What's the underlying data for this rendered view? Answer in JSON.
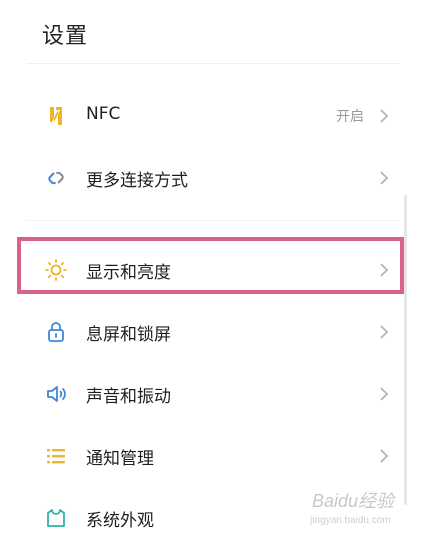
{
  "header": {
    "title": "设置"
  },
  "items": [
    {
      "label": "NFC",
      "value": "开启",
      "icon": "nfc-icon"
    },
    {
      "label": "更多连接方式",
      "value": "",
      "icon": "link-icon"
    },
    {
      "label": "显示和亮度",
      "value": "",
      "icon": "brightness-icon"
    },
    {
      "label": "息屏和锁屏",
      "value": "",
      "icon": "lock-icon"
    },
    {
      "label": "声音和振动",
      "value": "",
      "icon": "speaker-icon"
    },
    {
      "label": "通知管理",
      "value": "",
      "icon": "list-icon"
    },
    {
      "label": "系统外观",
      "value": "",
      "icon": "shirt-icon"
    }
  ],
  "watermark": {
    "text": "Baidu经验",
    "sub": "jingyan.baidu.com"
  },
  "colors": {
    "highlight": "#d9628a",
    "icon_yellow": "#f0b429",
    "icon_blue": "#3f87d6",
    "icon_teal": "#2fb3a8",
    "text": "#1f1f1f"
  }
}
